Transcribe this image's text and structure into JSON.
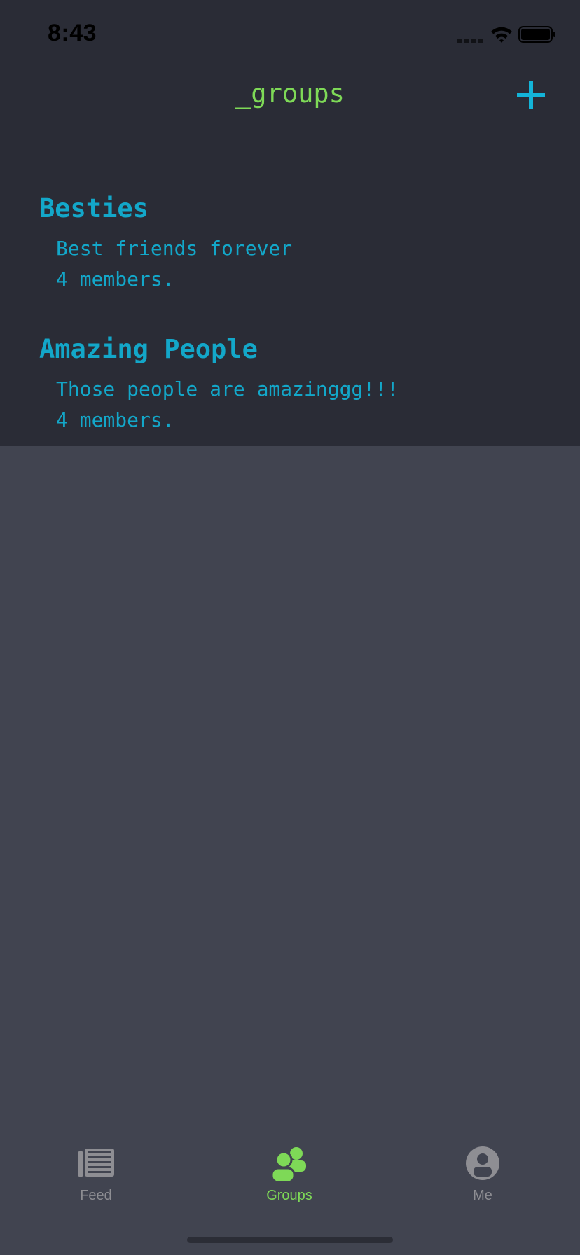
{
  "status_bar": {
    "time": "8:43"
  },
  "nav": {
    "title": "_groups",
    "add_icon": "plus-icon"
  },
  "groups": [
    {
      "name": "Besties",
      "description": "Best friends forever",
      "members": "4 members."
    },
    {
      "name": "Amazing People",
      "description": "Those people are amazinggg!!!",
      "members": "4 members."
    }
  ],
  "tab_bar": {
    "tabs": [
      {
        "label": "Feed",
        "icon": "newspaper-icon",
        "active": false
      },
      {
        "label": "Groups",
        "icon": "people-icon",
        "active": true
      },
      {
        "label": "Me",
        "icon": "person-circle-icon",
        "active": false
      }
    ]
  },
  "colors": {
    "background": "#414450",
    "list_background": "#2a2c36",
    "title_green": "#7ed957",
    "accent_cyan": "#13a7c9",
    "tab_inactive": "#8e8e93",
    "tab_active": "#7ed957"
  }
}
